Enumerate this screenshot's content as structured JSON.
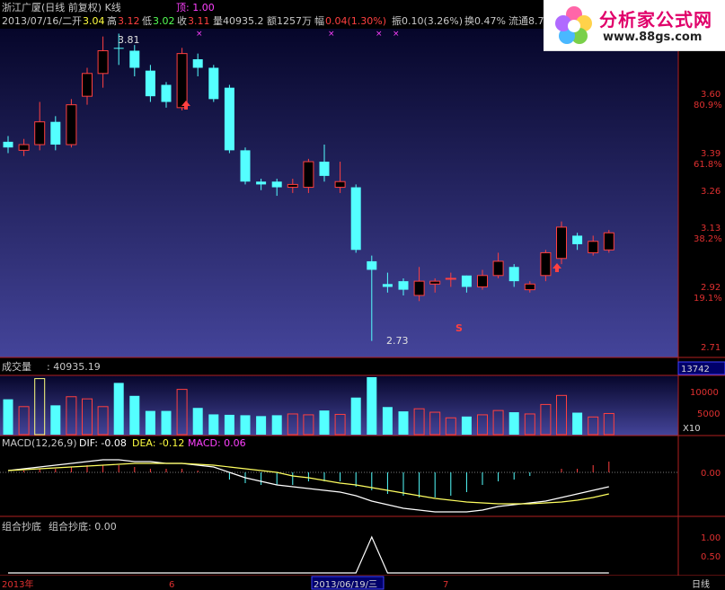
{
  "header": {
    "stock": "浙江广厦(日线 前复权) K线",
    "top_label": "顶: 1.00",
    "date": "2013/07/16/二",
    "open_label": "开",
    "open": "3.04",
    "high_label": "高",
    "high": "3.12",
    "low_label": "低",
    "low": "3.02",
    "close_label": "收",
    "close": "3.11",
    "vol": "量40935.2",
    "amount": "额1257万",
    "change_label": "幅",
    "change": "0.04(1.30%)",
    "amplitude": "振0.10(3.26%)",
    "turnover": "换0.47%",
    "float": "流通8.7"
  },
  "logo": {
    "title": "分析家公式网",
    "url": "www.88gs.com"
  },
  "price_axis": {
    "p1": "3.60",
    "pct1": "80.9%",
    "p2": "3.39",
    "pct2": "61.8%",
    "p3": "3.26",
    "p4": "3.13",
    "pct4": "38.2%",
    "p5": "2.92",
    "pct5": "19.1%",
    "p6": "2.71"
  },
  "annotations": {
    "high_mark": "3.81",
    "low_mark": "2.73",
    "s_mark": "S"
  },
  "volume": {
    "title": "成交量",
    "value": ": 40935.19",
    "box": "13742",
    "axis1": "10000",
    "axis2": "5000",
    "mult": "X10"
  },
  "macd": {
    "title": "MACD(12,26,9)",
    "dif": "DIF: -0.08",
    "dea": "DEA: -0.12",
    "macd": "MACD: 0.06",
    "axis": "0.00"
  },
  "combo": {
    "title": "组合抄底",
    "label": "组合抄底: 0.00",
    "axis1": "1.00",
    "axis2": "0.50"
  },
  "bottom": {
    "year": "2013年",
    "m6": "6",
    "cursor_date": "2013/06/19/三",
    "m7": "7",
    "period": "日线"
  },
  "colors": {
    "up": "#ff4040",
    "down": "#54ffff",
    "bg_grad_top": "#06062a",
    "bg_grad_bottom": "#44449a",
    "frame": "#b02020"
  },
  "chart_data": {
    "type": "candlestick",
    "candles": [
      {
        "o": 3.43,
        "c": 3.41,
        "h": 3.45,
        "l": 3.39,
        "up": false
      },
      {
        "o": 3.4,
        "c": 3.42,
        "h": 3.44,
        "l": 3.38,
        "up": true
      },
      {
        "o": 3.42,
        "c": 3.5,
        "h": 3.57,
        "l": 3.4,
        "up": true
      },
      {
        "o": 3.5,
        "c": 3.42,
        "h": 3.52,
        "l": 3.4,
        "up": false
      },
      {
        "o": 3.42,
        "c": 3.56,
        "h": 3.58,
        "l": 3.41,
        "up": true
      },
      {
        "o": 3.59,
        "c": 3.67,
        "h": 3.69,
        "l": 3.56,
        "up": true
      },
      {
        "o": 3.67,
        "c": 3.75,
        "h": 3.8,
        "l": 3.62,
        "up": true
      },
      {
        "o": 3.76,
        "c": 3.76,
        "h": 3.81,
        "l": 3.7,
        "up": false
      },
      {
        "o": 3.75,
        "c": 3.69,
        "h": 3.77,
        "l": 3.66,
        "up": false
      },
      {
        "o": 3.68,
        "c": 3.59,
        "h": 3.7,
        "l": 3.57,
        "up": false
      },
      {
        "o": 3.63,
        "c": 3.57,
        "h": 3.64,
        "l": 3.55,
        "up": false
      },
      {
        "o": 3.55,
        "c": 3.74,
        "h": 3.76,
        "l": 3.54,
        "up": true
      },
      {
        "o": 3.72,
        "c": 3.69,
        "h": 3.74,
        "l": 3.66,
        "up": false
      },
      {
        "o": 3.69,
        "c": 3.58,
        "h": 3.7,
        "l": 3.57,
        "up": false
      },
      {
        "o": 3.62,
        "c": 3.4,
        "h": 3.63,
        "l": 3.39,
        "up": false
      },
      {
        "o": 3.4,
        "c": 3.29,
        "h": 3.41,
        "l": 3.28,
        "up": false
      },
      {
        "o": 3.29,
        "c": 3.28,
        "h": 3.3,
        "l": 3.26,
        "up": false
      },
      {
        "o": 3.29,
        "c": 3.27,
        "h": 3.3,
        "l": 3.24,
        "up": false
      },
      {
        "o": 3.27,
        "c": 3.28,
        "h": 3.3,
        "l": 3.25,
        "up": true
      },
      {
        "o": 3.27,
        "c": 3.36,
        "h": 3.37,
        "l": 3.25,
        "up": true
      },
      {
        "o": 3.36,
        "c": 3.31,
        "h": 3.42,
        "l": 3.29,
        "up": false
      },
      {
        "o": 3.29,
        "c": 3.27,
        "h": 3.36,
        "l": 3.25,
        "up": true
      },
      {
        "o": 3.27,
        "c": 3.05,
        "h": 3.28,
        "l": 3.04,
        "up": false
      },
      {
        "o": 3.01,
        "c": 2.98,
        "h": 3.03,
        "l": 2.73,
        "up": false
      },
      {
        "o": 2.93,
        "c": 2.92,
        "h": 2.97,
        "l": 2.9,
        "up": false
      },
      {
        "o": 2.94,
        "c": 2.91,
        "h": 2.95,
        "l": 2.89,
        "up": false
      },
      {
        "o": 2.89,
        "c": 2.94,
        "h": 2.99,
        "l": 2.87,
        "up": true
      },
      {
        "o": 2.93,
        "c": 2.94,
        "h": 2.95,
        "l": 2.9,
        "up": true
      },
      {
        "o": 2.95,
        "c": 2.95,
        "h": 2.97,
        "l": 2.92,
        "up": true
      },
      {
        "o": 2.96,
        "c": 2.92,
        "h": 2.96,
        "l": 2.9,
        "up": false
      },
      {
        "o": 2.92,
        "c": 2.96,
        "h": 2.98,
        "l": 2.91,
        "up": true
      },
      {
        "o": 2.96,
        "c": 3.01,
        "h": 3.04,
        "l": 2.95,
        "up": true
      },
      {
        "o": 2.99,
        "c": 2.94,
        "h": 3.0,
        "l": 2.92,
        "up": false
      },
      {
        "o": 2.91,
        "c": 2.93,
        "h": 2.94,
        "l": 2.9,
        "up": true
      },
      {
        "o": 2.96,
        "c": 3.04,
        "h": 3.05,
        "l": 2.94,
        "up": true
      },
      {
        "o": 3.02,
        "c": 3.13,
        "h": 3.15,
        "l": 3.0,
        "up": true
      },
      {
        "o": 3.1,
        "c": 3.07,
        "h": 3.11,
        "l": 3.05,
        "up": false
      },
      {
        "o": 3.04,
        "c": 3.08,
        "h": 3.1,
        "l": 3.03,
        "up": true
      },
      {
        "o": 3.05,
        "c": 3.11,
        "h": 3.12,
        "l": 3.04,
        "up": true
      }
    ],
    "volumes": [
      8200,
      6500,
      13000,
      6800,
      8800,
      8300,
      6500,
      12000,
      9000,
      5500,
      5500,
      10500,
      6200,
      4700,
      4600,
      4500,
      4300,
      4500,
      4800,
      4600,
      5600,
      4700,
      8600,
      14500,
      6400,
      5400,
      6000,
      5200,
      3900,
      4200,
      4600,
      5600,
      5200,
      4800,
      7000,
      9100,
      5100,
      4100,
      4900
    ],
    "macd_hist": [
      0.0,
      0.01,
      0.02,
      0.02,
      0.03,
      0.04,
      0.04,
      0.04,
      0.03,
      0.02,
      0.02,
      0.02,
      0.01,
      0.0,
      -0.04,
      -0.06,
      -0.07,
      -0.07,
      -0.07,
      -0.05,
      -0.05,
      -0.05,
      -0.08,
      -0.1,
      -0.12,
      -0.13,
      -0.14,
      -0.14,
      -0.13,
      -0.11,
      -0.07,
      -0.05,
      -0.04,
      -0.02,
      0.0,
      0.02,
      0.02,
      0.04,
      0.06
    ],
    "dif": [
      0.01,
      0.02,
      0.03,
      0.04,
      0.05,
      0.06,
      0.07,
      0.07,
      0.06,
      0.06,
      0.05,
      0.05,
      0.04,
      0.03,
      0.0,
      -0.03,
      -0.05,
      -0.07,
      -0.08,
      -0.09,
      -0.1,
      -0.11,
      -0.13,
      -0.16,
      -0.18,
      -0.2,
      -0.21,
      -0.22,
      -0.22,
      -0.22,
      -0.21,
      -0.19,
      -0.18,
      -0.17,
      -0.16,
      -0.14,
      -0.12,
      -0.1,
      -0.08
    ],
    "dea": [
      0.01,
      0.015,
      0.02,
      0.025,
      0.03,
      0.035,
      0.04,
      0.045,
      0.05,
      0.05,
      0.05,
      0.05,
      0.045,
      0.04,
      0.03,
      0.02,
      0.01,
      0.0,
      -0.02,
      -0.03,
      -0.045,
      -0.06,
      -0.07,
      -0.085,
      -0.1,
      -0.115,
      -0.13,
      -0.145,
      -0.155,
      -0.165,
      -0.17,
      -0.175,
      -0.175,
      -0.175,
      -0.17,
      -0.165,
      -0.155,
      -0.14,
      -0.12
    ],
    "combo": [
      0,
      0,
      0,
      0,
      0,
      0,
      0,
      0,
      0,
      0,
      0,
      0,
      0,
      0,
      0,
      0,
      0,
      0,
      0,
      0,
      0,
      0,
      0,
      1,
      0,
      0,
      0,
      0,
      0,
      0,
      0,
      0,
      0,
      0,
      0,
      0,
      0,
      0,
      0
    ]
  }
}
